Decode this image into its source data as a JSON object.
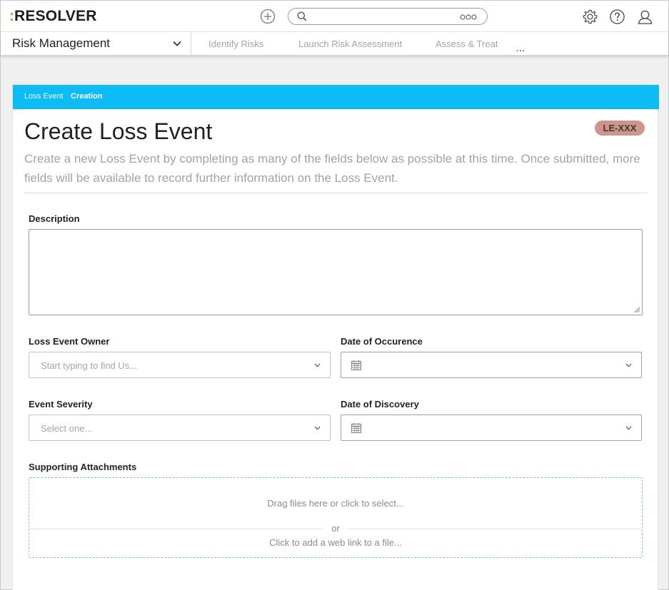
{
  "topbar": {
    "logo_text": "RESOLVER",
    "search": {
      "value": "",
      "placeholder": ""
    },
    "icons": [
      "add-circle-icon",
      "search-icon",
      "more-options-icon",
      "gear-icon",
      "help-icon",
      "user-icon"
    ]
  },
  "nav": {
    "app_name": "Risk Management",
    "links": [
      "Identify Risks",
      "Launch Risk Assessment",
      "Assess & Treat"
    ],
    "more": "..."
  },
  "card": {
    "breadcrumb": {
      "first": "Loss Event",
      "second": "Creation"
    },
    "title": "Create Loss Event",
    "badge": "LE-XXX",
    "intro": "Create a new Loss Event by completing as many of the fields below as possible at this time. Once submitted, more fields will be available to record further information on the Loss Event.",
    "fields": {
      "description": {
        "label": "Description",
        "value": ""
      },
      "owner": {
        "label": "Loss Event Owner",
        "placeholder": "Start typing to find Us..."
      },
      "occurrence": {
        "label": "Date of Occurence",
        "value": ""
      },
      "severity": {
        "label": "Event Severity",
        "placeholder": "Select one..."
      },
      "discovery": {
        "label": "Date of Discovery",
        "value": ""
      },
      "attachments": {
        "label": "Supporting Attachments",
        "drop_text": "Drag files here or click to select...",
        "or_text": "or",
        "link_text": "Click to add a web link to a file..."
      }
    }
  },
  "colors": {
    "accent": "#0dbbf5",
    "badge": "#d0958a",
    "logo_dots": "#7cc242",
    "dropzone_border": "#7fc8b2"
  }
}
